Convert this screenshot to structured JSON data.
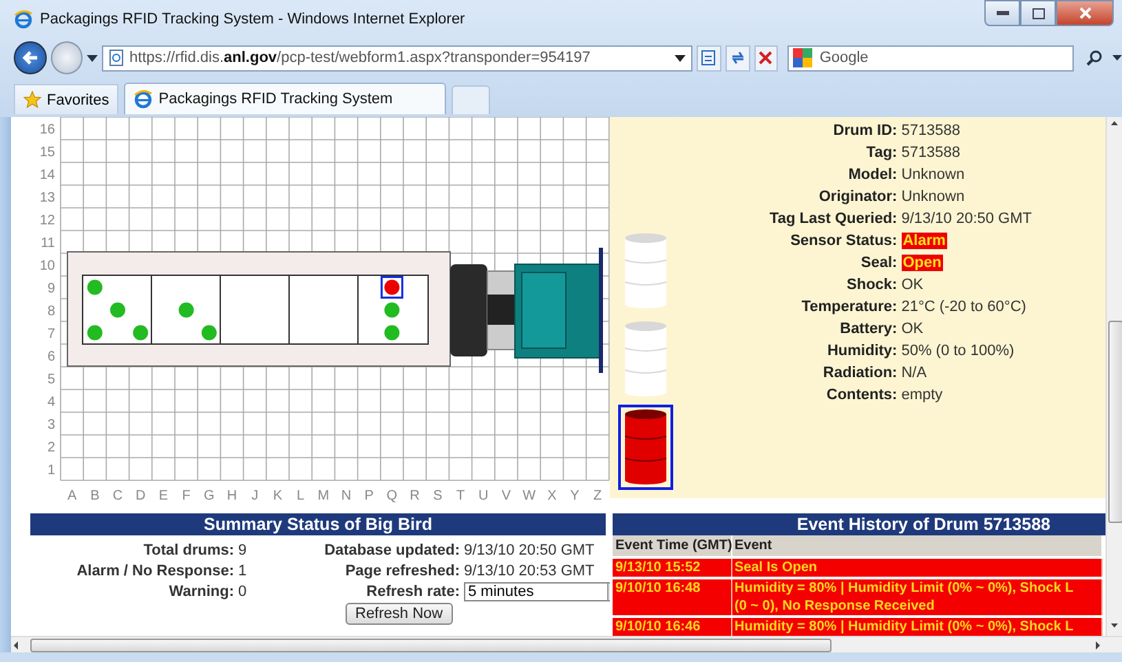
{
  "window": {
    "title": "Packagings RFID Tracking System - Windows Internet Explorer"
  },
  "browser": {
    "address": "https://rfid.dis.**anl.gov**/pcp-test/webform1.aspx?transponder=954197",
    "search_placeholder": "Google",
    "favorites": "Favorites",
    "tab": "Packagings RFID Tracking System"
  },
  "grid": {
    "rows": [
      "16",
      "15",
      "14",
      "13",
      "12",
      "11",
      "10",
      "9",
      "8",
      "7",
      "6",
      "5",
      "4",
      "3",
      "2",
      "1"
    ],
    "columns": [
      "A",
      "B",
      "C",
      "D",
      "E",
      "F",
      "G",
      "H",
      "J",
      "K",
      "L",
      "M",
      "N",
      "P",
      "Q",
      "R",
      "S",
      "T",
      "U",
      "V",
      "W",
      "X",
      "Y",
      "Z"
    ],
    "drums": [
      {
        "color": "#22bb22",
        "selected": false
      },
      {
        "color": "#22bb22",
        "selected": false
      },
      {
        "color": "#22bb22",
        "selected": false
      },
      {
        "color": "#22bb22",
        "selected": false
      },
      {
        "color": "#22bb22",
        "selected": false
      },
      {
        "color": "#22bb22",
        "selected": false
      },
      {
        "color": "#ee0000",
        "selected": true
      },
      {
        "color": "#22bb22",
        "selected": false
      },
      {
        "color": "#22bb22",
        "selected": false
      }
    ]
  },
  "details": {
    "fields": [
      {
        "label": "Drum ID:",
        "value": "5713588",
        "alert": false
      },
      {
        "label": "Tag:",
        "value": "5713588",
        "alert": false
      },
      {
        "label": "Model:",
        "value": "Unknown",
        "alert": false
      },
      {
        "label": "Originator:",
        "value": "Unknown",
        "alert": false
      },
      {
        "label": "Tag Last Queried:",
        "value": "9/13/10 20:50 GMT",
        "alert": false
      },
      {
        "label": "Sensor Status:",
        "value": "Alarm",
        "alert": true
      },
      {
        "label": "Seal:",
        "value": "Open",
        "alert": true
      },
      {
        "label": "Shock:",
        "value": "OK",
        "alert": false
      },
      {
        "label": "Temperature:",
        "value": "21°C (-20 to 60°C)",
        "alert": false
      },
      {
        "label": "Battery:",
        "value": "OK",
        "alert": false
      },
      {
        "label": "Humidity:",
        "value": "50% (0 to 100%)",
        "alert": false
      },
      {
        "label": "Radiation:",
        "value": "N/A",
        "alert": false
      },
      {
        "label": "Contents:",
        "value": "empty",
        "alert": false
      }
    ]
  },
  "drum_stack": [
    {
      "color": "#ffffff",
      "selected": false
    },
    {
      "color": "#ffffff",
      "selected": false
    },
    {
      "color": "#e00000",
      "selected": true
    }
  ],
  "summary": {
    "title": "Summary Status of Big Bird",
    "stats": [
      {
        "label": "Total drums:",
        "value": "9"
      },
      {
        "label": "Alarm / No Response:",
        "value": "1"
      },
      {
        "label": "Warning:",
        "value": "0"
      }
    ],
    "info": [
      {
        "label": "Database updated:",
        "value": "9/13/10 20:50 GMT"
      },
      {
        "label": "Page refreshed:",
        "value": "9/13/10 20:53 GMT"
      }
    ],
    "refresh_label": "Refresh rate:",
    "refresh_rate": "5 minutes",
    "button": "Refresh Now"
  },
  "events": {
    "title": "Event History of Drum 5713588",
    "columns": [
      "Event Time (GMT)",
      "Event"
    ],
    "rows": [
      {
        "time": "9/13/10 15:52",
        "lines": [
          "Seal Is Open"
        ]
      },
      {
        "time": "9/10/10 16:48",
        "lines": [
          "Humidity = 80% | Humidity Limit (0% ~ 0%), Shock L",
          "(0 ~ 0), No Response Received"
        ]
      },
      {
        "time": "9/10/10 16:46",
        "lines": [
          "Humidity = 80% | Humidity Limit (0% ~ 0%), Shock L"
        ]
      }
    ]
  }
}
